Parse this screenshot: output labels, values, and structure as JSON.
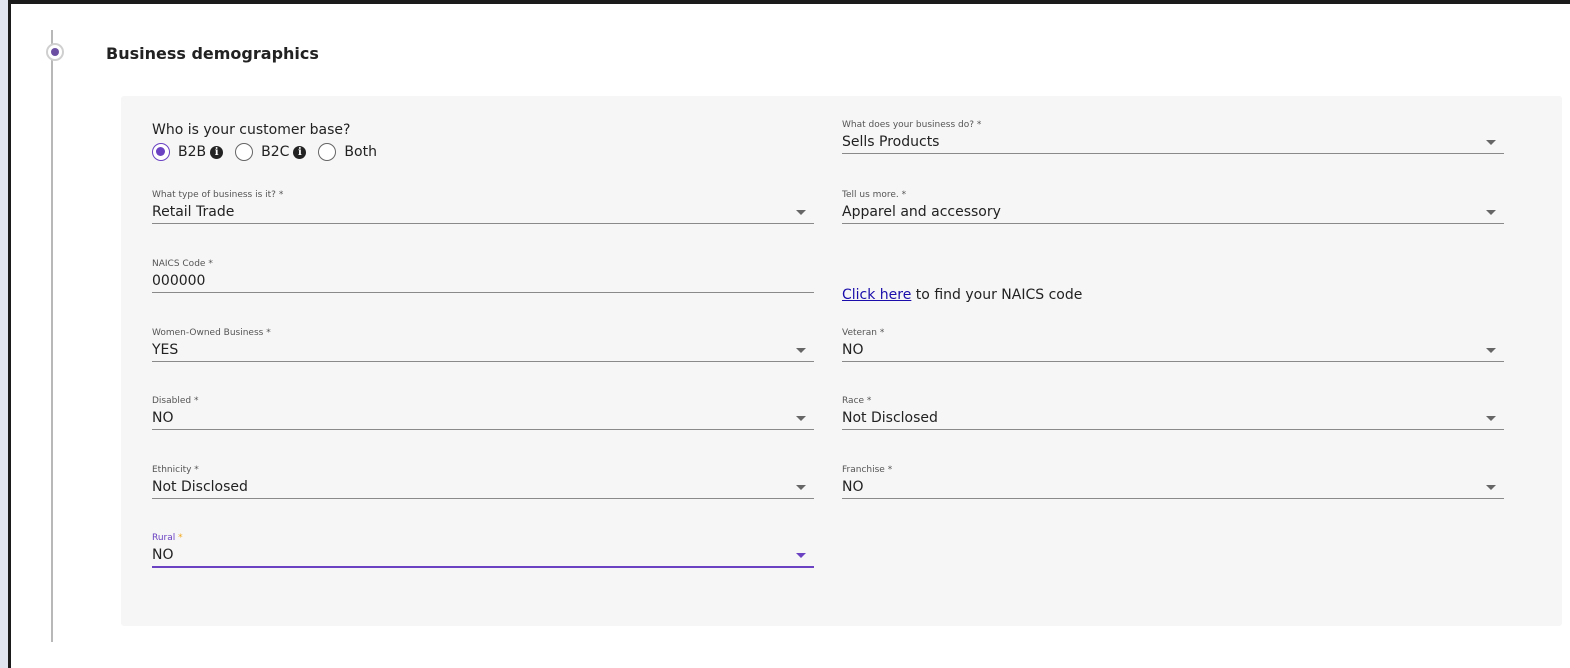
{
  "section": {
    "title": "Business demographics"
  },
  "customer_base": {
    "question": "Who is your customer base?",
    "options": [
      {
        "label": "B2B",
        "checked": true,
        "info_icon": "info-circle-icon"
      },
      {
        "label": "B2C",
        "checked": false,
        "info_icon": "info-circle-icon"
      },
      {
        "label": "Both",
        "checked": false
      }
    ]
  },
  "fields": {
    "business_do": {
      "label": "What does your business do?",
      "required_mark": " *",
      "value": "Sells Products"
    },
    "business_type": {
      "label": "What type of business is it?",
      "required_mark": " *",
      "value": "Retail Trade"
    },
    "tell_more": {
      "label": "Tell us more.",
      "required_mark": " *",
      "value": "Apparel and accessory"
    },
    "naics": {
      "label": "NAICS Code",
      "required_mark": " *",
      "value": "000000"
    },
    "women_owned": {
      "label": "Women-Owned Business",
      "required_mark": " *",
      "value": "YES"
    },
    "veteran": {
      "label": "Veteran",
      "required_mark": " *",
      "value": "NO"
    },
    "disabled": {
      "label": "Disabled",
      "required_mark": " *",
      "value": "NO"
    },
    "race": {
      "label": "Race",
      "required_mark": " *",
      "value": "Not Disclosed"
    },
    "ethnicity": {
      "label": "Ethnicity",
      "required_mark": " *",
      "value": "Not Disclosed"
    },
    "franchise": {
      "label": "Franchise",
      "required_mark": " *",
      "value": "NO"
    },
    "rural": {
      "label": "Rural",
      "required_mark": " *",
      "value": "NO"
    }
  },
  "naics_help": {
    "link_text": "Click here",
    "rest_text": " to find your NAICS code"
  },
  "colors": {
    "accent": "#6a42c2",
    "required_focus": "#f2a81d",
    "link": "#1a0dab"
  }
}
